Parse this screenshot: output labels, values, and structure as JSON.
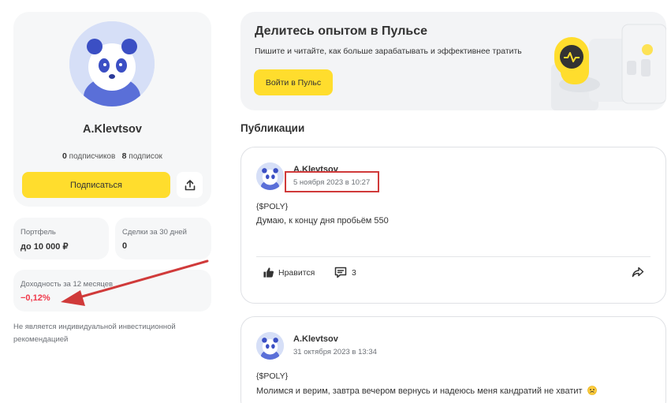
{
  "profile": {
    "username": "A.Klevtsov",
    "followers_count": "0",
    "followers_label": "подписчиков",
    "following_count": "8",
    "following_label": "подписок",
    "subscribe_label": "Подписаться"
  },
  "stats": {
    "portfolio_label": "Портфель",
    "portfolio_value": "до 10 000 ₽",
    "deals_label": "Сделки за 30 дней",
    "deals_value": "0",
    "yield_label": "Доходность за 12 месяцев",
    "yield_value": "−0,12%"
  },
  "disclaimer": "Не является индивидуальной инвестиционной рекомендацией",
  "banner": {
    "title": "Делитесь опытом в Пульсе",
    "text": "Пишите и читайте, как больше зарабатывать и эффективнее тратить",
    "button_label": "Войти в Пульс"
  },
  "section_title": "Публикации",
  "posts": [
    {
      "author": "A.Klevtsov",
      "date": "5 ноября 2023 в 10:27",
      "ticker": "{$POLY}",
      "text": "Думаю, к концу дня пробьём 550",
      "like_label": "Нравится",
      "comments_count": "3"
    },
    {
      "author": "A.Klevtsov",
      "date": "31 октября 2023 в 13:34",
      "ticker": "{$POLY}",
      "text": "Молимся и верим, завтра вечером вернусь и надеюсь меня кандратий не хватит"
    }
  ],
  "colors": {
    "accent": "#ffdd2d",
    "negative": "#f0394b",
    "annotation": "#d03a3a"
  }
}
